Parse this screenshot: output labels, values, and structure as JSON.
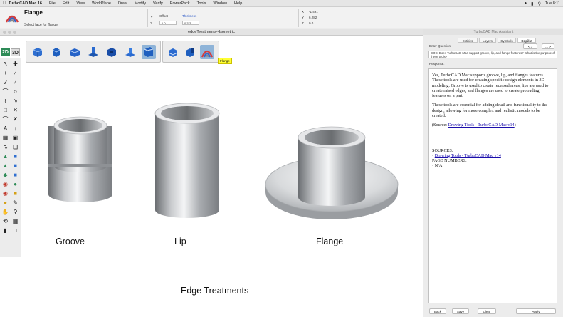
{
  "menubar": {
    "apple": "",
    "items": [
      "TurboCAD Mac 16",
      "File",
      "Edit",
      "View",
      "WorkPlane",
      "Draw",
      "Modify",
      "Verify",
      "PowerPack",
      "Tools",
      "Window",
      "Help"
    ],
    "clock": "Tue 8:11"
  },
  "inspector": {
    "tool_name": "Flange",
    "hint": "Select face for flange",
    "offset_label": "Offset",
    "offset_value": "1.0",
    "thickness_label": "Thickness",
    "thickness_value": "0.375",
    "x_label": "X",
    "x_value": "-1.491",
    "y_label": "Y",
    "y_value": "6.282",
    "z_label": "Z",
    "z_value": "0.0"
  },
  "drawing": {
    "window_title": "edgeTreatments--Isometric",
    "labels": {
      "groove": "Groove",
      "lip": "Lip",
      "flange": "Flange",
      "caption": "Edge Treatments"
    },
    "tooltip": "Flange"
  },
  "toolbar_icons": [
    "box-icon",
    "cylinder-icon",
    "sphere-icon",
    "extrude-icon",
    "revolve-icon",
    "sweep-icon",
    "shell-icon",
    "groove-icon",
    "lip-icon",
    "flange-icon"
  ],
  "left_tools": {
    "mode_2d": "2D",
    "mode_3d": "3D"
  },
  "ai_panel": {
    "title": "TurboCAD Mac Assistant",
    "tabs": [
      "Entities",
      "Layers",
      "Symbols",
      "Copilot"
    ],
    "active_tab": "Copilot",
    "enter_question_label": "Enter Question",
    "question": "DOC: Does TurboCAD Mac support groove, lip, and flange features? What is the purpose of these tools?",
    "response_label": "Response:",
    "response_p1": "Yes, TurboCAD Mac supports groove, lip, and flanges features. These tools are used for creating specific design elements in 3D modeling. Groove is used to create recessed areas, lips are used to create raised edges, and flanges are used to create protruding features on a part.",
    "response_p2": "These tools are essential for adding detail and functionality to the design, allowing for more complex and realistic models to be created.",
    "source_prefix": "(Source: ",
    "source_link": "Drawing Tools - TurboCAD Mac v14",
    "source_suffix": ")",
    "sources_heading": "SOURCES:",
    "sources_item": "Drawing Tools - TurboCAD Mac v14",
    "page_numbers_heading": "PAGE NUMBERS:",
    "page_numbers_item": "N/A",
    "buttons": {
      "back": "Back",
      "save": "Save",
      "clear": "Clear",
      "apply": "Apply"
    }
  },
  "colors": {
    "menubar_bg": "#e6e6e6",
    "panel_bg": "#ececec",
    "selected_tool": "#8fb4d8",
    "tooltip_bg": "#ffff33",
    "link": "#1a0dab",
    "mode_2d": "#2e8b57"
  }
}
